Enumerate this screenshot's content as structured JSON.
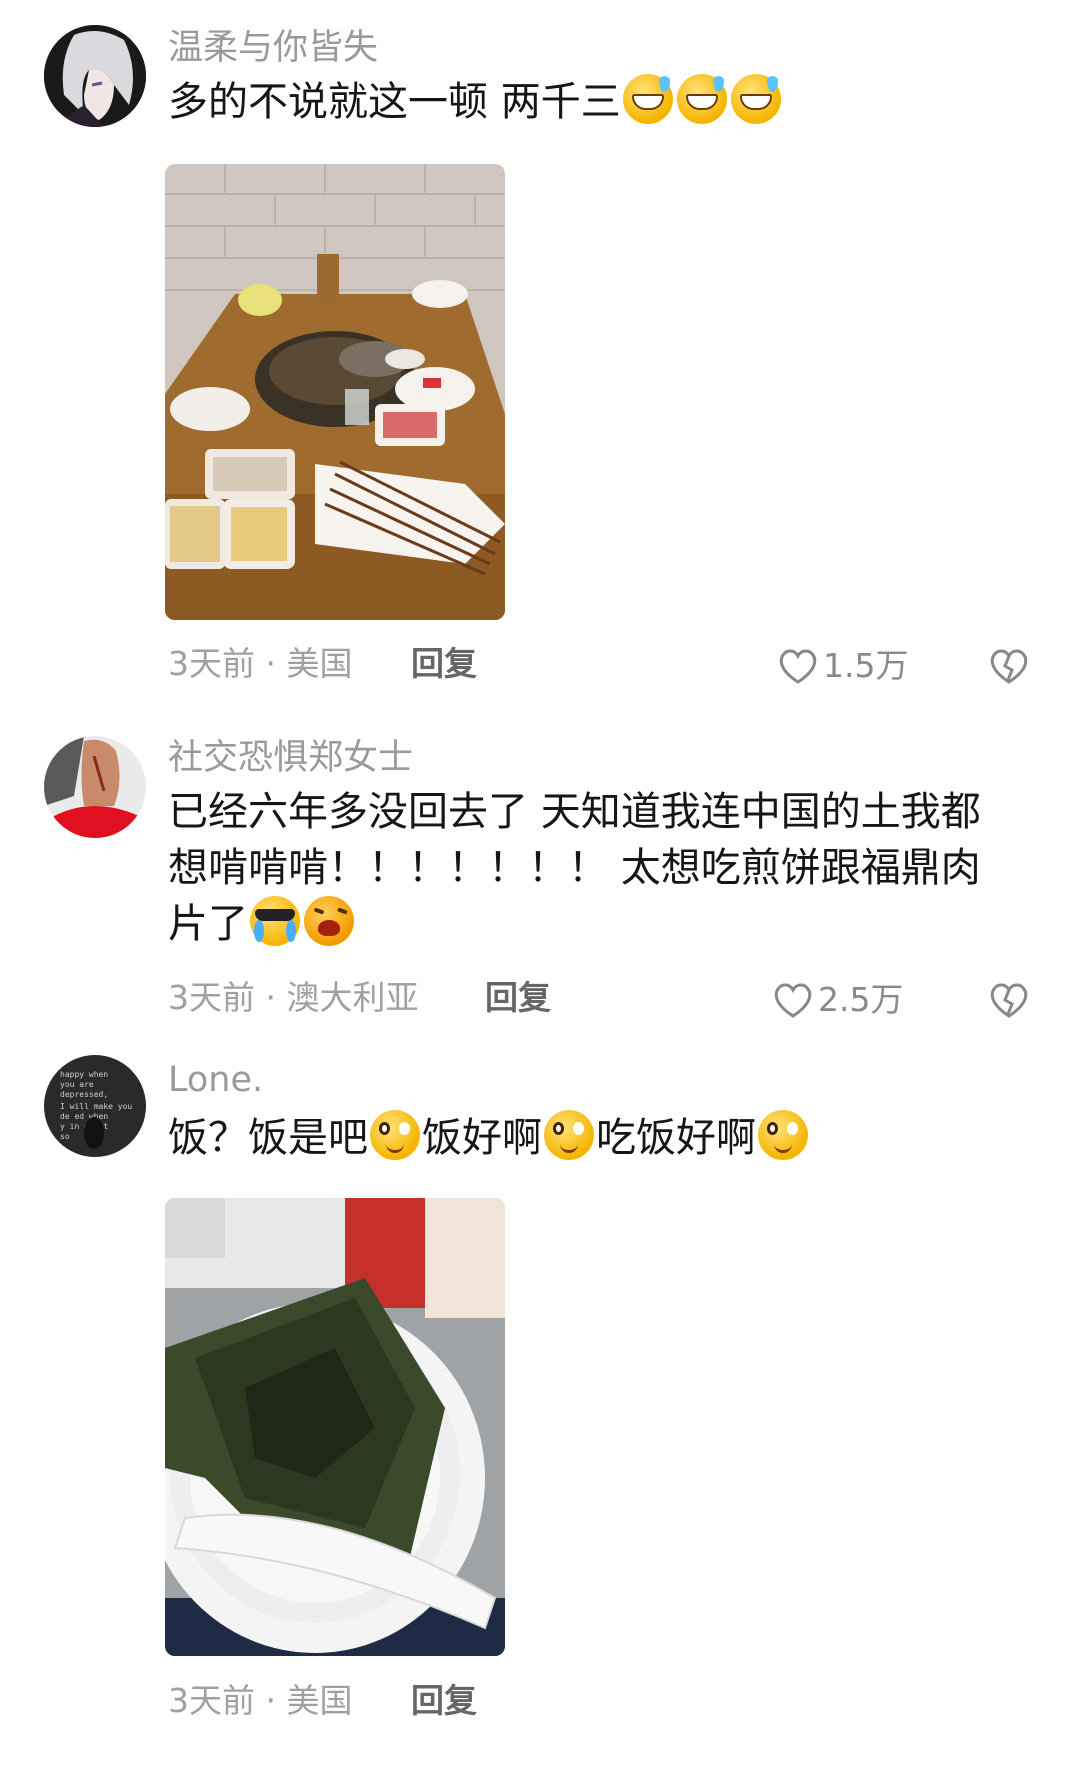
{
  "comments": [
    {
      "username": "温柔与你皆失",
      "text": "多的不说就这一顿 两千三",
      "emoji": [
        "sweat-grin-emoji",
        "sweat-grin-emoji",
        "sweat-grin-emoji"
      ],
      "image": "hotpot-table-photo",
      "time": "3天前",
      "location": "美国",
      "reply_label": "回复",
      "likes": "1.5万"
    },
    {
      "username": "社交恐惧郑女士",
      "text_line1": "已经六年多没回去了 天知道我连中国的土我都",
      "text_line2": "想啃啃啃！！！！！！！ 太想吃煎饼跟福鼎肉",
      "text_line3": "片了",
      "emoji": [
        "cool-tears-emoji",
        "crying-emoji"
      ],
      "time": "3天前",
      "location": "澳大利亚",
      "reply_label": "回复",
      "likes": "2.5万"
    },
    {
      "username": "Lone.",
      "text_parts": [
        "饭？饭是吧",
        "饭好啊",
        "吃饭好啊"
      ],
      "emoji": [
        "wide-eyed-emoji",
        "wide-eyed-emoji",
        "wide-eyed-emoji"
      ],
      "image": "rice-seaweed-photo",
      "time": "3天前",
      "location": "美国",
      "reply_label": "回复"
    }
  ],
  "separator": "·",
  "colors": {
    "meta": "#a0a0a0",
    "text": "#161616",
    "username": "#9a9a9a"
  }
}
